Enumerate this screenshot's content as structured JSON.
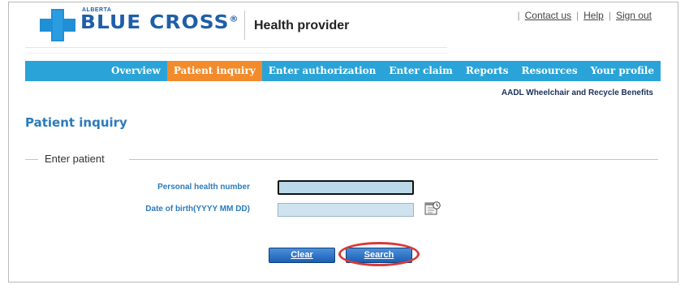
{
  "brand": {
    "alberta": "ALBERTA",
    "name": "BLUE CROSS",
    "registered": "®",
    "product": "Health provider",
    "cross_color": "#1f8fd6"
  },
  "top_links": {
    "contact": "Contact us",
    "help": "Help",
    "signout": "Sign out"
  },
  "nav": {
    "items": [
      {
        "label": "Overview",
        "active": false
      },
      {
        "label": "Patient inquiry",
        "active": true
      },
      {
        "label": "Enter authorization",
        "active": false
      },
      {
        "label": "Enter claim",
        "active": false
      },
      {
        "label": "Reports",
        "active": false
      },
      {
        "label": "Resources",
        "active": false
      },
      {
        "label": "Your profile",
        "active": false
      }
    ],
    "bar_color": "#2aa4d8",
    "active_color": "#f28b2c"
  },
  "sub_link": "AADL Wheelchair and Recycle Benefits",
  "page": {
    "title": "Patient inquiry",
    "legend": "Enter patient"
  },
  "form": {
    "phn_label": "Personal health number",
    "phn_value": "",
    "dob_label": "Date of birth(YYYY MM DD)",
    "dob_value": "",
    "calendar_icon": "calendar-icon"
  },
  "buttons": {
    "clear": "Clear",
    "search": "Search"
  }
}
